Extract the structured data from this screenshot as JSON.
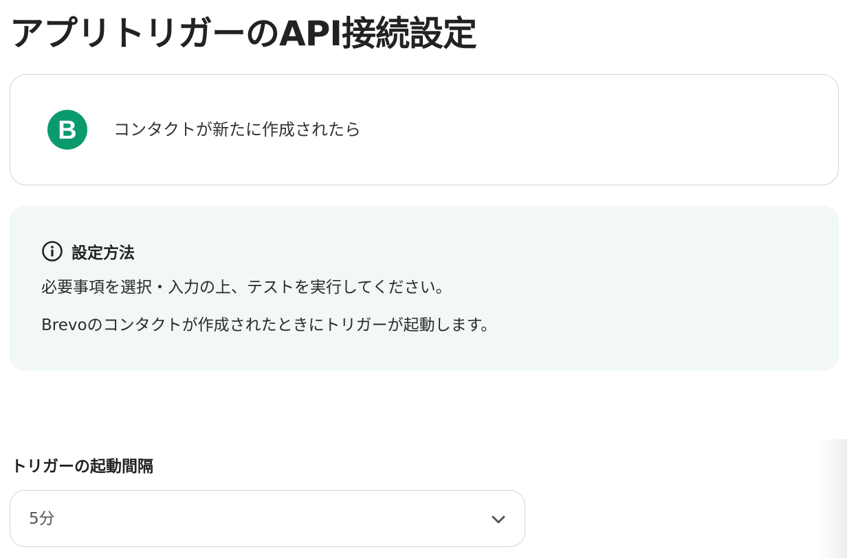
{
  "page": {
    "title": "アプリトリガーのAPI接続設定"
  },
  "trigger": {
    "app_icon": "brevo-logo-icon",
    "app_letter": "B",
    "label": "コンタクトが新たに作成されたら",
    "brand_color": "#0b9a6d"
  },
  "info": {
    "icon": "info-circle-icon",
    "title": "設定方法",
    "lines": [
      "必要事項を選択・入力の上、テストを実行してください。",
      "Brevoのコンタクトが作成されたときにトリガーが起動します。"
    ],
    "background_color": "#f1f8f7"
  },
  "interval": {
    "label": "トリガーの起動間隔",
    "selected": "5分",
    "chevron_icon": "chevron-down-icon"
  }
}
